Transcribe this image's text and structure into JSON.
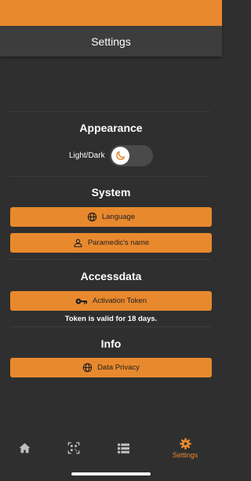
{
  "header": {
    "title": "Settings"
  },
  "appearance": {
    "title": "Appearance",
    "toggle_label": "Light/Dark",
    "toggle_icon": "moon-icon"
  },
  "system": {
    "title": "System",
    "buttons": [
      {
        "label": "Language",
        "icon": "globe-icon"
      },
      {
        "label": "Paramedic's name",
        "icon": "person-icon"
      }
    ]
  },
  "accessdata": {
    "title": "Accessdata",
    "button": {
      "label": "Activation Token",
      "icon": "key-icon"
    },
    "note": "Token is valid for 18 days."
  },
  "info": {
    "title": "Info",
    "button": {
      "label": "Data Privacy",
      "icon": "globe-icon"
    }
  },
  "tabbar": {
    "tabs": [
      {
        "icon": "home-icon",
        "label": ""
      },
      {
        "icon": "qr-scan-icon",
        "label": ""
      },
      {
        "icon": "list-icon",
        "label": ""
      },
      {
        "icon": "gear-icon",
        "label": "Settings",
        "active": true
      }
    ]
  },
  "colors": {
    "accent": "#e8892e",
    "background": "#2f2f2f",
    "header": "#3d3d3d",
    "text": "#ffffff",
    "button_text": "#1f1f1f"
  }
}
